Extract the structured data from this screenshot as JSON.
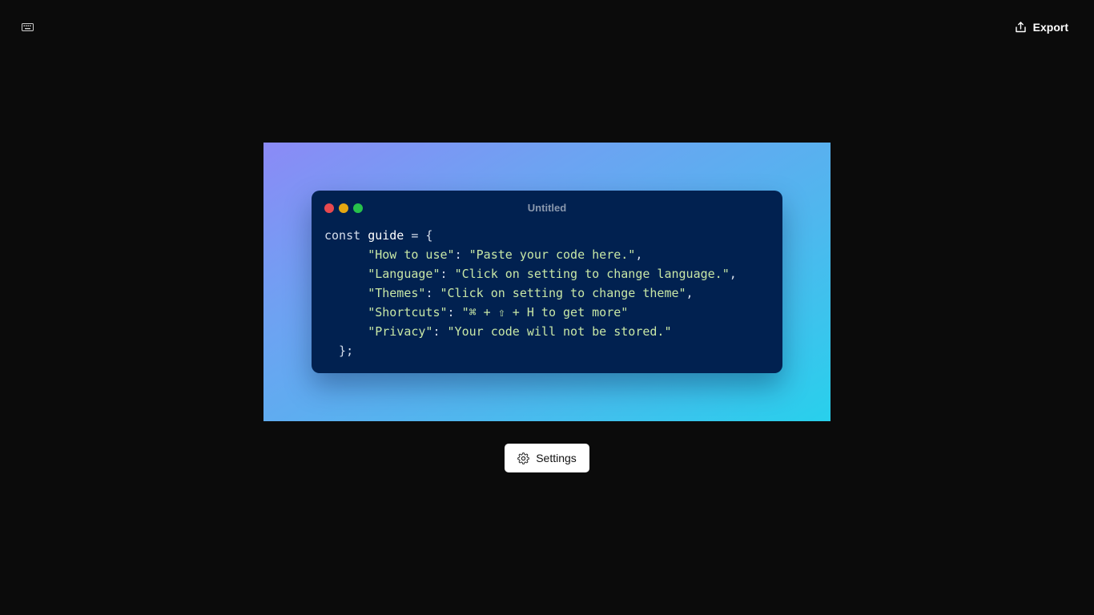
{
  "toolbar": {
    "keyboard_icon": "keyboard-icon",
    "export_label": "Export",
    "export_icon": "share-icon"
  },
  "snippet": {
    "title": "Untitled",
    "background_gradient": [
      "#8b8af6",
      "#6ea2f2",
      "#4fb7ee",
      "#28d0ec"
    ],
    "window_color": "#012150",
    "dots": [
      {
        "name": "close",
        "color": "#e8494f"
      },
      {
        "name": "minimize",
        "color": "#e5a711"
      },
      {
        "name": "maximize",
        "color": "#27c14b"
      }
    ],
    "code_lines": [
      [
        {
          "t": "kw",
          "v": "const "
        },
        {
          "t": "id",
          "v": "guide"
        },
        {
          "t": "punc",
          "v": " = {"
        }
      ],
      [
        {
          "t": "punc",
          "v": "      "
        },
        {
          "t": "str",
          "v": "\"How to use\""
        },
        {
          "t": "punc",
          "v": ": "
        },
        {
          "t": "str",
          "v": "\"Paste your code here.\""
        },
        {
          "t": "punc",
          "v": ","
        }
      ],
      [
        {
          "t": "punc",
          "v": "      "
        },
        {
          "t": "str",
          "v": "\"Language\""
        },
        {
          "t": "punc",
          "v": ": "
        },
        {
          "t": "str",
          "v": "\"Click on setting to change language.\""
        },
        {
          "t": "punc",
          "v": ","
        }
      ],
      [
        {
          "t": "punc",
          "v": "      "
        },
        {
          "t": "str",
          "v": "\"Themes\""
        },
        {
          "t": "punc",
          "v": ": "
        },
        {
          "t": "str",
          "v": "\"Click on setting to change theme\""
        },
        {
          "t": "punc",
          "v": ","
        }
      ],
      [
        {
          "t": "punc",
          "v": "      "
        },
        {
          "t": "str",
          "v": "\"Shortcuts\""
        },
        {
          "t": "punc",
          "v": ": "
        },
        {
          "t": "str",
          "v": "\"⌘ + ⇧ + H to get more\""
        }
      ],
      [
        {
          "t": "punc",
          "v": "      "
        },
        {
          "t": "str",
          "v": "\"Privacy\""
        },
        {
          "t": "punc",
          "v": ": "
        },
        {
          "t": "str",
          "v": "\"Your code will not be stored.\""
        }
      ],
      [
        {
          "t": "punc",
          "v": "  };"
        }
      ]
    ]
  },
  "settings": {
    "label": "Settings",
    "icon": "gear-icon"
  }
}
